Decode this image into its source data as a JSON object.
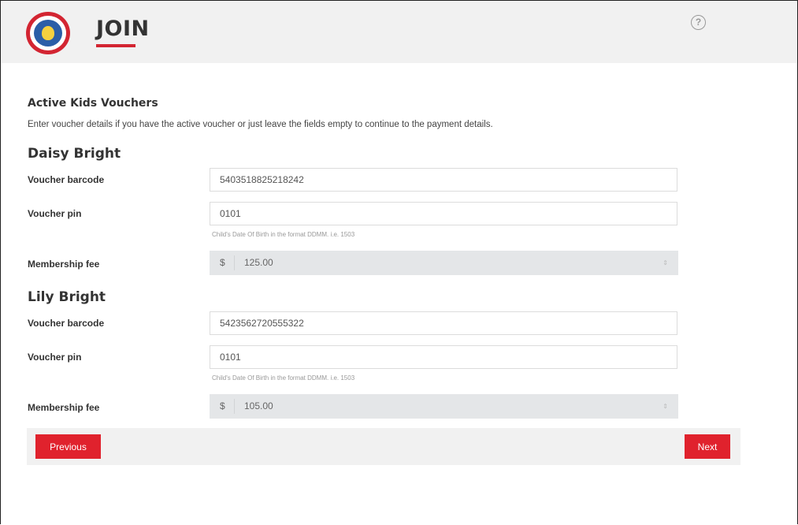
{
  "header": {
    "title": "JOIN",
    "help_glyph": "?"
  },
  "section": {
    "title": "Active Kids Vouchers",
    "intro": "Enter voucher details if you have the active voucher or just leave the fields empty to continue to the payment details."
  },
  "children": [
    {
      "name": "Daisy Bright",
      "barcode_label": "Voucher barcode",
      "barcode_value": "5403518825218242",
      "pin_label": "Voucher pin",
      "pin_value": "0101",
      "pin_hint": "Child's Date Of Birth in the format DDMM. i.e. 1503",
      "fee_label": "Membership fee",
      "fee_currency": "$",
      "fee_value": "125.00",
      "fee_spinner": "⇕"
    },
    {
      "name": "Lily Bright",
      "barcode_label": "Voucher barcode",
      "barcode_value": "5423562720555322",
      "pin_label": "Voucher pin",
      "pin_value": "0101",
      "pin_hint": "Child's Date Of Birth in the format DDMM. i.e. 1503",
      "fee_label": "Membership fee",
      "fee_currency": "$",
      "fee_value": "105.00",
      "fee_spinner": "⇕"
    }
  ],
  "nav": {
    "previous_label": "Previous",
    "next_label": "Next"
  },
  "colors": {
    "accent": "#e0222d",
    "header_bg": "#f1f1f1",
    "fee_bg": "#e4e6e8"
  },
  "icons": {
    "logo": "surf-life-saving-logo",
    "help": "help-circle-icon"
  }
}
